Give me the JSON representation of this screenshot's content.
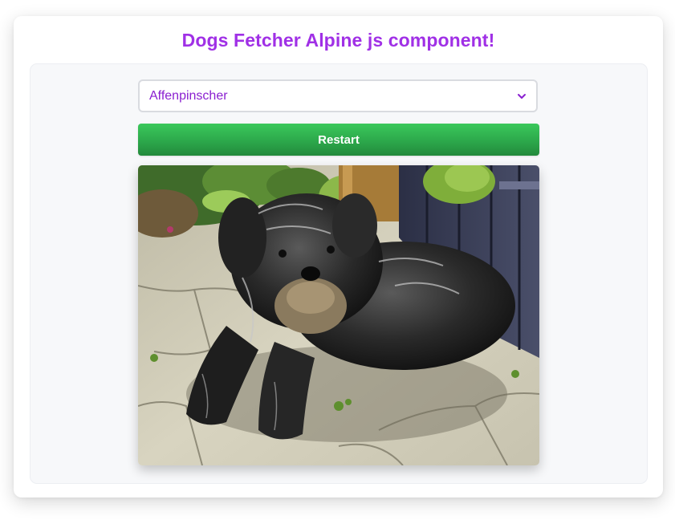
{
  "header": {
    "title": "Dogs Fetcher Alpine js component!"
  },
  "breed_select": {
    "selected": "Affenpinscher"
  },
  "restart_button": {
    "label": "Restart"
  },
  "dog_photo": {
    "alt": "Affenpinscher dog"
  },
  "colors": {
    "title": "#a030e6",
    "select_text": "#8a1fd0",
    "button": "#2ca84b",
    "panel_bg": "#f7f8fa"
  }
}
